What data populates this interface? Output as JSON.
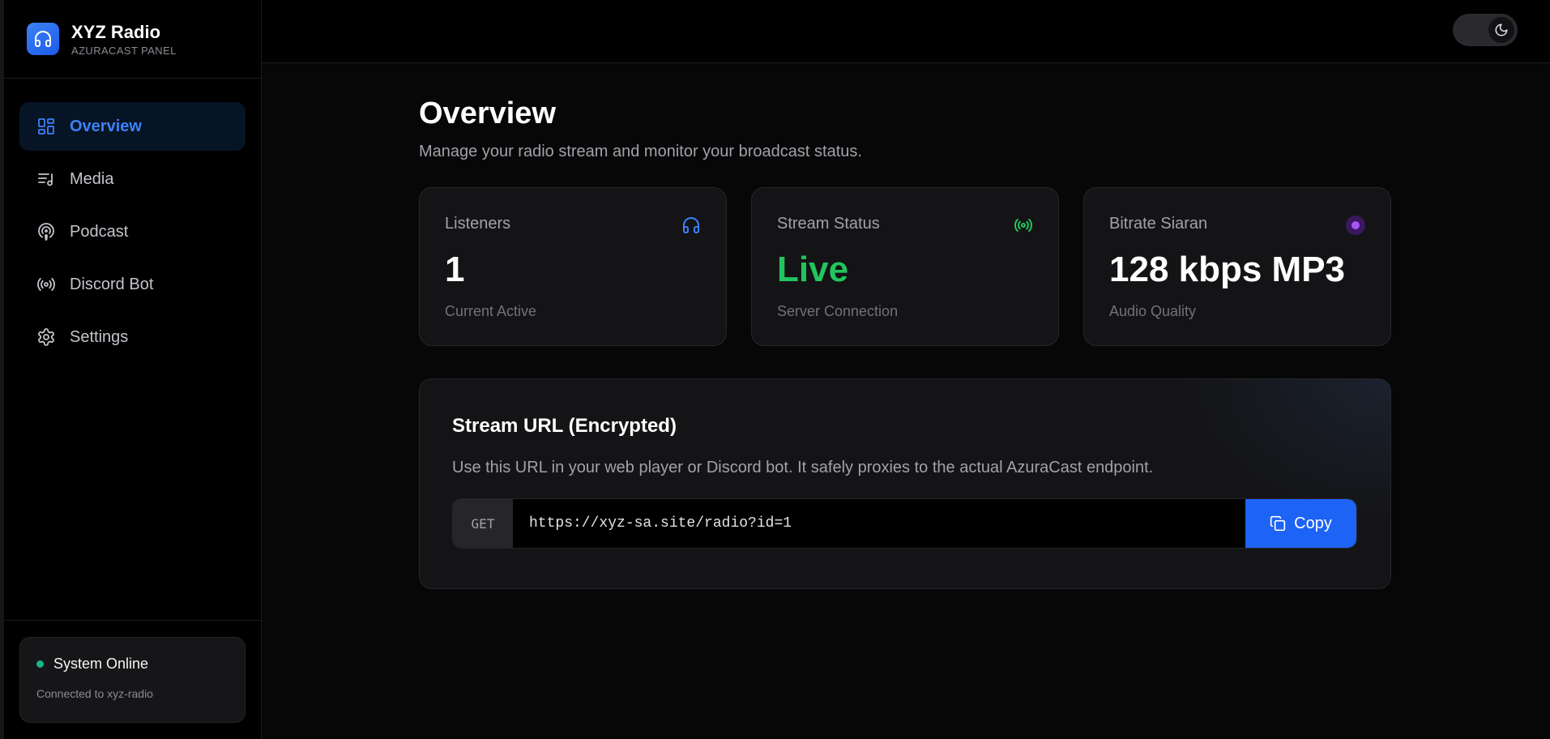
{
  "brand": {
    "title": "XYZ Radio",
    "subtitle": "AZURACAST PANEL",
    "icon": "headphones-icon"
  },
  "sidebar": {
    "items": [
      {
        "label": "Overview",
        "icon": "dashboard-grid-icon",
        "active": true
      },
      {
        "label": "Media",
        "icon": "music-list-icon",
        "active": false
      },
      {
        "label": "Podcast",
        "icon": "podcast-icon",
        "active": false
      },
      {
        "label": "Discord Bot",
        "icon": "broadcast-icon",
        "active": false
      },
      {
        "label": "Settings",
        "icon": "gear-icon",
        "active": false
      }
    ],
    "status": {
      "title": "System Online",
      "subtitle": "Connected to xyz-radio",
      "color": "#10b981"
    }
  },
  "topbar": {
    "theme_toggle_icon": "moon-icon"
  },
  "page": {
    "title": "Overview",
    "subtitle": "Manage your radio stream and monitor your broadcast status."
  },
  "stats": [
    {
      "label": "Listeners",
      "value": "1",
      "caption": "Current Active",
      "icon": "headphones-icon",
      "icon_color": "#3b82f6"
    },
    {
      "label": "Stream Status",
      "value": "Live",
      "caption": "Server Connection",
      "icon": "broadcast-icon",
      "icon_color": "#22c55e"
    },
    {
      "label": "Bitrate Siaran",
      "value": "128 kbps MP3",
      "caption": "Audio Quality",
      "icon": "record-dot-icon",
      "icon_color": "#a855f7"
    }
  ],
  "stream_url": {
    "title": "Stream URL (Encrypted)",
    "description": "Use this URL in your web player or Discord bot. It safely proxies to the actual AzuraCast endpoint.",
    "method": "GET",
    "url": "https://xyz-sa.site/radio?id=1",
    "copy_label": "Copy",
    "copy_icon": "copy-icon"
  },
  "colors": {
    "accent": "#1d63f5",
    "live": "#22c55e",
    "background": "#070708"
  }
}
